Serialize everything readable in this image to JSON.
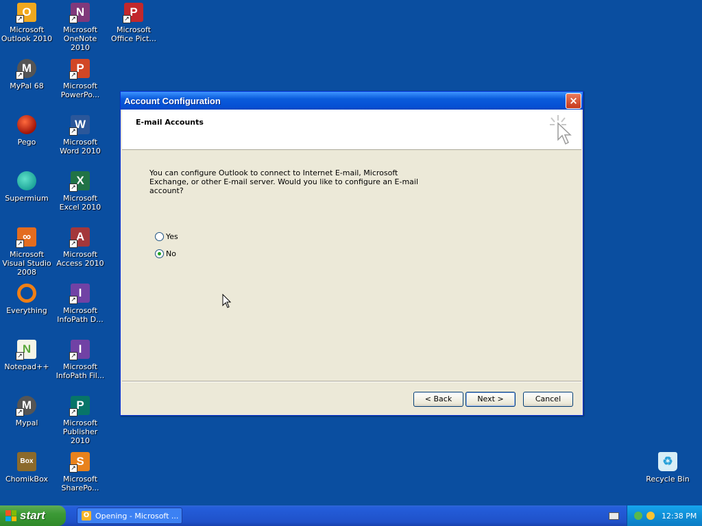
{
  "desktop": {
    "icons": [
      {
        "label": "Microsoft Outlook 2010",
        "glyph": "O",
        "color": "#f0a81f"
      },
      {
        "label": "Microsoft OneNote 2010",
        "glyph": "N",
        "color": "#80397b"
      },
      {
        "label": "Microsoft Office Pict...",
        "glyph": "P",
        "color": "#c2282c"
      },
      {
        "label": "MyPal 68",
        "glyph": "M",
        "color": "#555555"
      },
      {
        "label": "Microsoft PowerPo...",
        "glyph": "P",
        "color": "#d24726"
      },
      {
        "label": "Pego",
        "glyph": "",
        "color": "#a0140a"
      },
      {
        "label": "Microsoft Word 2010",
        "glyph": "W",
        "color": "#2b579a"
      },
      {
        "label": "Supermium",
        "glyph": "",
        "color": "#1ea69a"
      },
      {
        "label": "Microsoft Excel 2010",
        "glyph": "X",
        "color": "#217346"
      },
      {
        "label": "Microsoft Visual Studio 2008",
        "glyph": "∞",
        "color": "#e36c1f"
      },
      {
        "label": "Microsoft Access 2010",
        "glyph": "A",
        "color": "#a4373a"
      },
      {
        "label": "Everything",
        "glyph": "",
        "color": "#f07f15"
      },
      {
        "label": "Microsoft InfoPath D...",
        "glyph": "I",
        "color": "#7142a5"
      },
      {
        "label": "Notepad++",
        "glyph": "N",
        "color": "#5aa73a"
      },
      {
        "label": "Microsoft InfoPath Fil...",
        "glyph": "I",
        "color": "#7142a5"
      },
      {
        "label": "Mypal",
        "glyph": "M",
        "color": "#555555"
      },
      {
        "label": "Microsoft Publisher 2010",
        "glyph": "P",
        "color": "#077568"
      },
      {
        "label": "ChomikBox",
        "glyph": "Box",
        "color": "#8b6a2b"
      },
      {
        "label": "Microsoft SharePo...",
        "glyph": "S",
        "color": "#e8821d"
      },
      {
        "label": "Recycle Bin",
        "glyph": "♻",
        "color": "#2aa1d9"
      }
    ]
  },
  "dialog": {
    "title": "Account Configuration",
    "close_glyph": "×",
    "header_title": "E-mail Accounts",
    "body_text": "You can configure Outlook to connect to Internet E-mail, Microsoft Exchange, or other E-mail server. Would you like to configure an E-mail account?",
    "radio_yes": "Yes",
    "radio_no": "No",
    "selected": "No",
    "back_label": "< Back",
    "next_label": "Next >",
    "cancel_label": "Cancel"
  },
  "taskbar": {
    "start_label": "start",
    "task_label": "Opening - Microsoft ...",
    "clock": "12:38 PM"
  }
}
